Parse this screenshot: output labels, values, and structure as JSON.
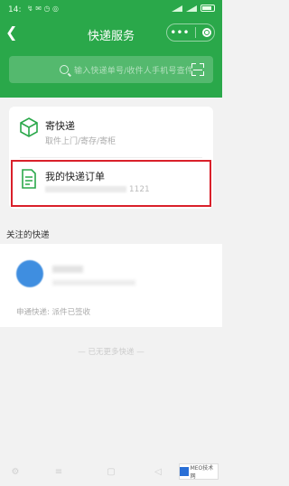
{
  "status_bar": {
    "time": "14:",
    "left_icons": "↯ ✉ ◷ ◎",
    "battery": ""
  },
  "header": {
    "title": "快递服务",
    "search_placeholder": "输入快递单号/收件人手机号查件"
  },
  "services": {
    "send": {
      "title": "寄快递",
      "subtitle": "取件上门/寄存/寄柜"
    },
    "orders": {
      "title": "我的快递订单",
      "subtitle_suffix": "1121"
    }
  },
  "follow": {
    "section_title": "关注的快递",
    "item": {
      "name": "",
      "sub": "",
      "line": "申通快递: 派件已签收"
    }
  },
  "footer": {
    "hint": "— 已无更多快递 —"
  },
  "watermark": {
    "text": "MEO技术网"
  },
  "colors": {
    "brand_green": "#2aa84a",
    "highlight_red": "#d9202a"
  }
}
